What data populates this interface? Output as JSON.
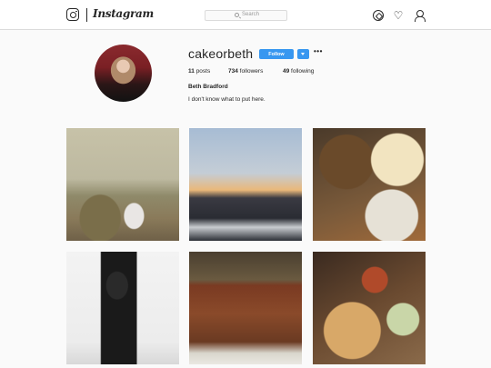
{
  "header": {
    "brand": "Instagram",
    "search_placeholder": "Search",
    "icons": [
      "instagram-logo-icon",
      "compass-icon",
      "heart-icon",
      "user-icon"
    ]
  },
  "profile": {
    "username": "cakeorbeth",
    "follow_label": "Follow",
    "more_label": "•••",
    "stats": {
      "posts": "11",
      "posts_label": "posts",
      "followers": "734",
      "followers_label": "followers",
      "following": "49",
      "following_label": "following"
    },
    "full_name": "Beth Bradford",
    "bio": "I don't know what to put here."
  },
  "colors": {
    "accent": "#3897f0",
    "background": "#fafafa",
    "text": "#262626",
    "border": "#dbdbdb"
  },
  "posts": [
    {
      "subject": "photo-palm-trees"
    },
    {
      "subject": "photo-sunset-road"
    },
    {
      "subject": "photo-brunch-food"
    },
    {
      "subject": "photo-leather-jacket"
    },
    {
      "subject": "photo-wooden-board"
    },
    {
      "subject": "photo-nachos"
    }
  ]
}
